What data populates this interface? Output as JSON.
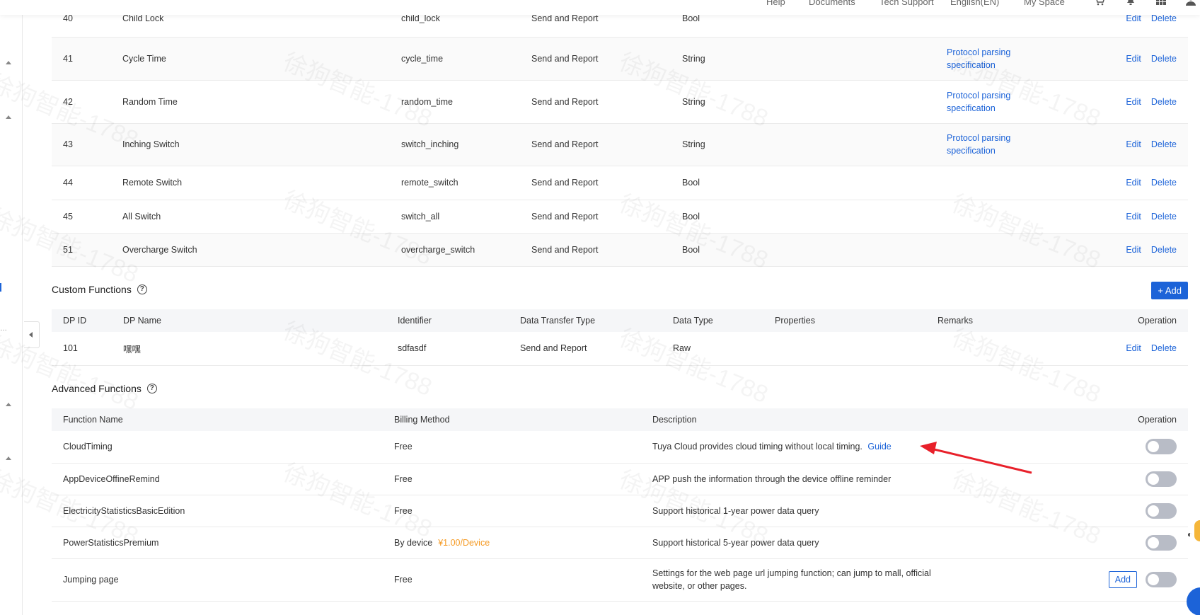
{
  "topnav": {
    "items": [
      "Help",
      "Documents",
      "Tech Support",
      "English(EN)",
      "My Space"
    ]
  },
  "standard_rows": [
    {
      "id": "40",
      "name": "Child Lock",
      "identifier": "child_lock",
      "transfer": "Send and Report",
      "type": "Bool",
      "remark": ""
    },
    {
      "id": "41",
      "name": "Cycle Time",
      "identifier": "cycle_time",
      "transfer": "Send and Report",
      "type": "String",
      "remark": "Protocol parsing specification"
    },
    {
      "id": "42",
      "name": "Random Time",
      "identifier": "random_time",
      "transfer": "Send and Report",
      "type": "String",
      "remark": "Protocol parsing specification"
    },
    {
      "id": "43",
      "name": "Inching Switch",
      "identifier": "switch_inching",
      "transfer": "Send and Report",
      "type": "String",
      "remark": "Protocol parsing specification"
    },
    {
      "id": "44",
      "name": "Remote Switch",
      "identifier": "remote_switch",
      "transfer": "Send and Report",
      "type": "Bool",
      "remark": ""
    },
    {
      "id": "45",
      "name": "All Switch",
      "identifier": "switch_all",
      "transfer": "Send and Report",
      "type": "Bool",
      "remark": ""
    },
    {
      "id": "51",
      "name": "Overcharge Switch",
      "identifier": "overcharge_switch",
      "transfer": "Send and Report",
      "type": "Bool",
      "remark": ""
    }
  ],
  "ops": {
    "edit": "Edit",
    "delete": "Delete"
  },
  "custom": {
    "title": "Custom Functions",
    "help": "?",
    "add_label": "+ Add",
    "headers": [
      "DP ID",
      "DP Name",
      "Identifier",
      "Data Transfer Type",
      "Data Type",
      "Properties",
      "Remarks",
      "Operation"
    ],
    "rows": [
      {
        "id": "101",
        "name": "嘿嘿",
        "identifier": "sdfasdf",
        "transfer": "Send and Report",
        "type": "Raw",
        "properties": "",
        "remarks": ""
      }
    ]
  },
  "advanced": {
    "title": "Advanced Functions",
    "help": "?",
    "headers": [
      "Function Name",
      "Billing Method",
      "Description",
      "Operation"
    ],
    "rows": [
      {
        "name": "CloudTiming",
        "billing": "Free",
        "price": "",
        "description": "Tuya Cloud provides cloud timing without local timing.",
        "link": "Guide",
        "enabled": false
      },
      {
        "name": "AppDeviceOffineRemind",
        "billing": "Free",
        "price": "",
        "description": "APP push the information through the device offline reminder",
        "link": "",
        "enabled": false
      },
      {
        "name": "ElectricityStatisticsBasicEdition",
        "billing": "Free",
        "price": "",
        "description": "Support historical 1-year power data query",
        "link": "",
        "enabled": false
      },
      {
        "name": "PowerStatisticsPremium",
        "billing": "By device",
        "price": "¥1.00/Device",
        "description": "Support historical 5-year power data query",
        "link": "",
        "enabled": false
      },
      {
        "name": "Jumping page",
        "billing": "Free",
        "price": "",
        "description": "Settings for the web page url jumping function; can jump to mall, official website, or other pages.",
        "link": "",
        "enabled": false,
        "add_label": "Add"
      }
    ]
  },
  "watermark": "徐狗智能-1788",
  "colors": {
    "accent": "#1c63d8",
    "price": "#f59a23",
    "toggle_off": "#b8bcc6",
    "arrow": "#e8202a"
  }
}
